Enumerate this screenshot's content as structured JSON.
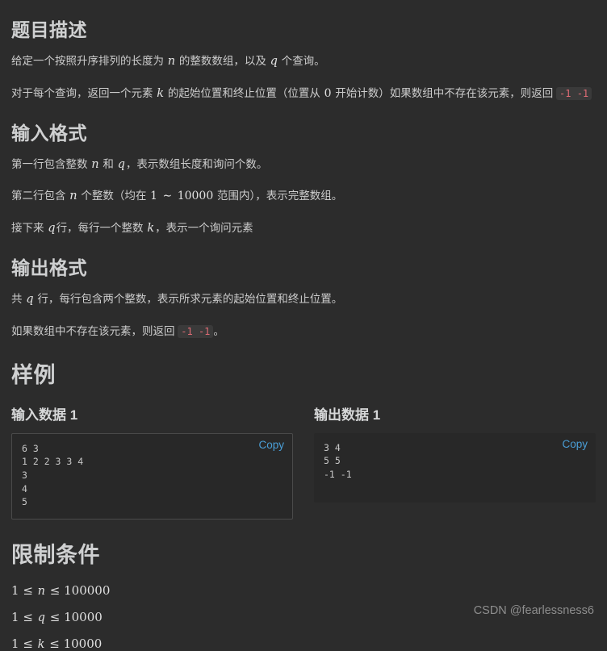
{
  "sections": {
    "description": {
      "title": "题目描述",
      "para1_a": "给定一个按照升序排列的长度为 ",
      "para1_n": "n",
      "para1_b": " 的整数数组，以及 ",
      "para1_q": "q",
      "para1_c": " 个查询。",
      "para2_a": "对于每个查询，返回一个元素 ",
      "para2_k": "k",
      "para2_b": " 的起始位置和终止位置（位置从 ",
      "para2_zero": "0",
      "para2_c": " 开始计数）如果数组中不存在该元素，则返回 ",
      "para2_code": "-1 -1"
    },
    "input_format": {
      "title": "输入格式",
      "line1_a": "第一行包含整数 ",
      "line1_n": "n",
      "line1_b": " 和 ",
      "line1_q": "q",
      "line1_c": "，表示数组长度和询问个数。",
      "line2_a": "第二行包含 ",
      "line2_n": "n",
      "line2_b": " 个整数（均在 ",
      "line2_one": "1",
      "line2_tilde": " ∼ ",
      "line2_max": "10000",
      "line2_c": " 范围内），表示完整数组。",
      "line3_a": "接下来 ",
      "line3_q": "q",
      "line3_b": "行，每行一个整数 ",
      "line3_k": "k",
      "line3_c": "，表示一个询问元素"
    },
    "output_format": {
      "title": "输出格式",
      "line1_a": "共 ",
      "line1_q": "q",
      "line1_b": " 行，每行包含两个整数，表示所求元素的起始位置和终止位置。",
      "line2_a": "如果数组中不存在该元素，则返回 ",
      "line2_code": "-1 -1",
      "line2_b": "。"
    },
    "samples": {
      "title": "样例",
      "input": {
        "label": "输入数据 1",
        "copy_label": "Copy",
        "content": "6 3\n1 2 2 3 3 4\n3\n4\n5"
      },
      "output": {
        "label": "输出数据 1",
        "copy_label": "Copy",
        "content": "3 4\n5 5\n-1 -1"
      }
    },
    "constraints": {
      "title": "限制条件",
      "lines": [
        {
          "lo": "1",
          "rel1": " ≤ ",
          "var": "n",
          "rel2": " ≤ ",
          "hi": "100000"
        },
        {
          "lo": "1",
          "rel1": " ≤ ",
          "var": "q",
          "rel2": " ≤ ",
          "hi": "10000"
        },
        {
          "lo": "1",
          "rel1": " ≤ ",
          "var": "k",
          "rel2": " ≤ ",
          "hi": "10000"
        }
      ]
    }
  },
  "watermark": "CSDN @fearlessness6"
}
